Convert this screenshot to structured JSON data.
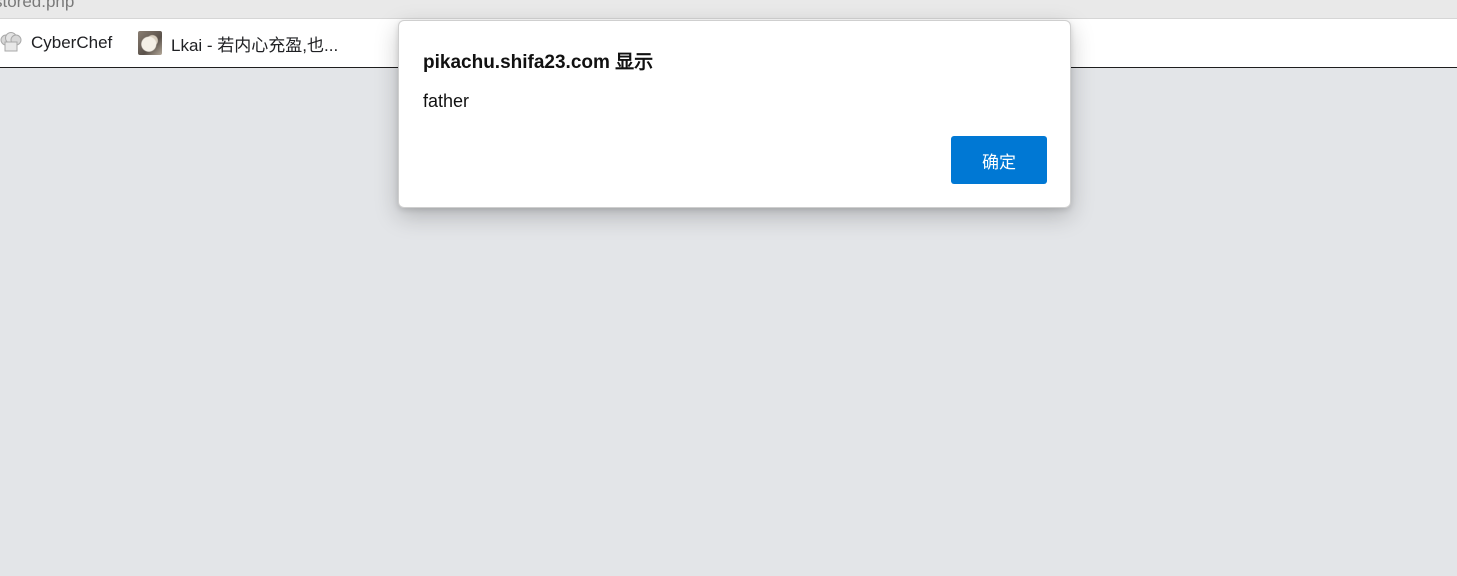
{
  "browser": {
    "address_text": "stored.php",
    "bookmarks": [
      {
        "label": "CyberChef",
        "icon": "chef-hat-icon"
      },
      {
        "label": "Lkai - 若内心充盈,也...",
        "icon": "thumbnail-icon"
      }
    ]
  },
  "dialog": {
    "title": "pikachu.shifa23.com 显示",
    "message": "father",
    "ok_label": "确定"
  },
  "colors": {
    "page_background": "#e3e5e8",
    "dialog_background": "#ffffff",
    "accent": "#0078d4"
  }
}
